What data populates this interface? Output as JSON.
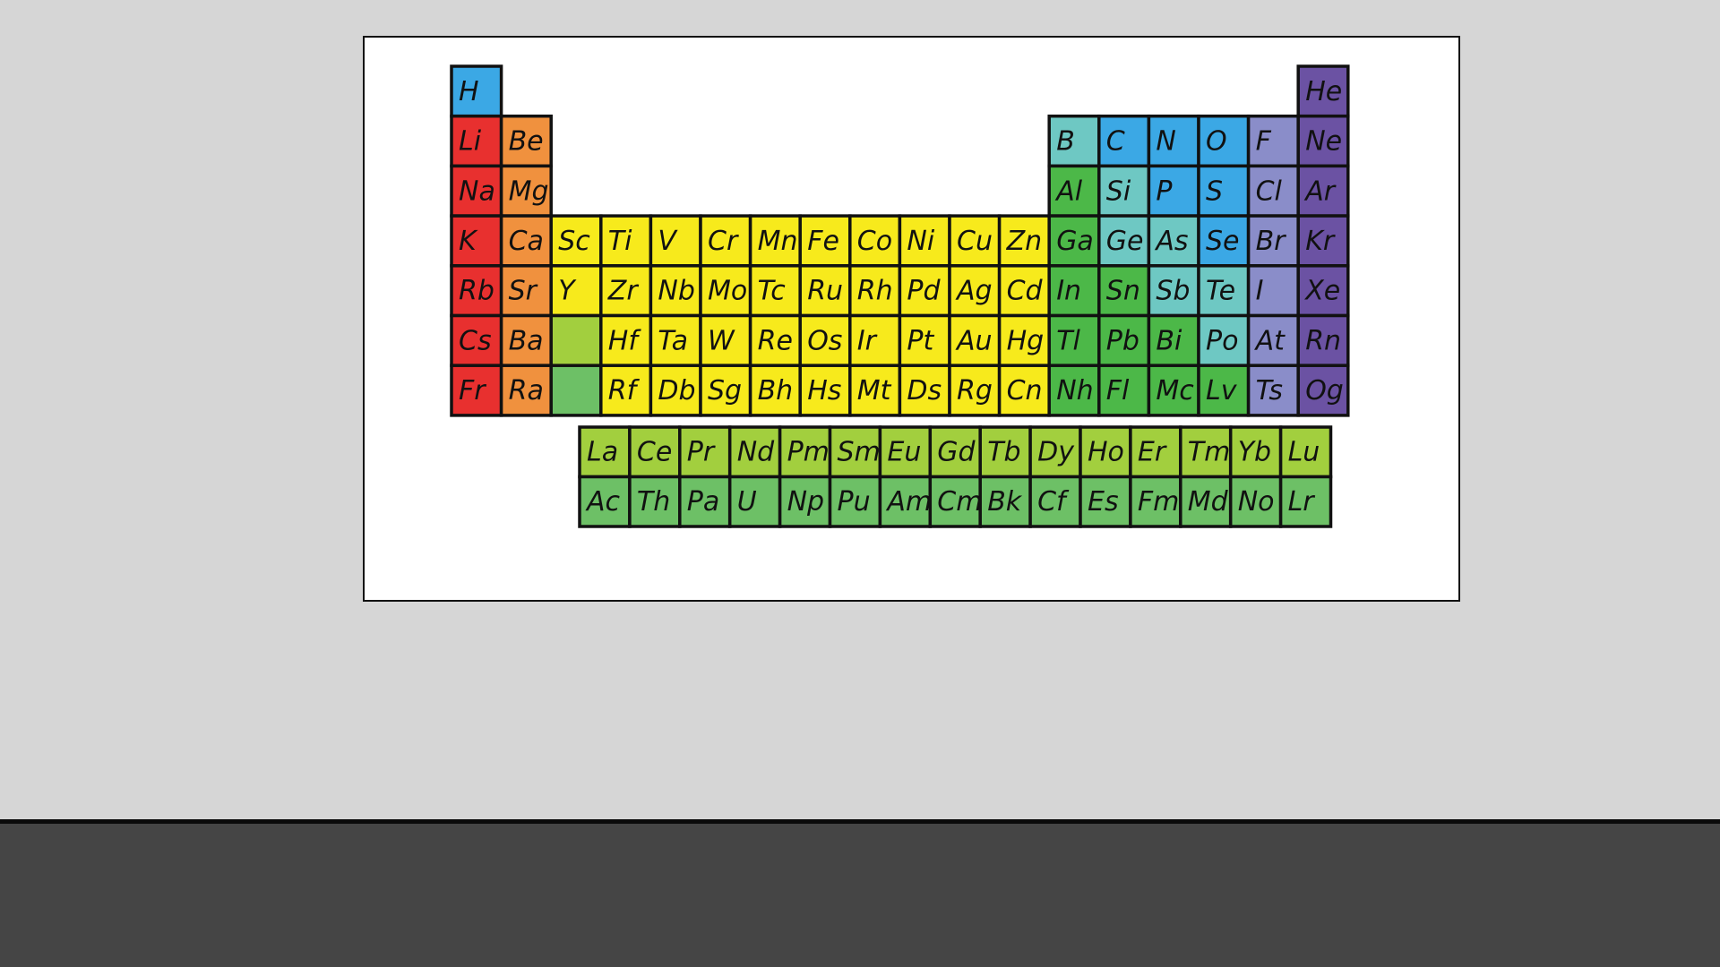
{
  "colors": {
    "page_background": "#d6d6d6",
    "card_background": "#ffffff",
    "bottom_bar": "#454545",
    "cell_border": "#111111",
    "alkali_metal": "#e8302f",
    "alkaline_earth": "#f0913e",
    "transition_metal": "#f7ea1c",
    "lanthanide": "#a2cf3e",
    "actinide": "#6dc066",
    "post_transition": "#4cb848",
    "metalloid": "#6ec8c3",
    "nonmetal": "#3ba8e5",
    "halogen": "#8a8dc9",
    "noble_gas": "#6b52a3"
  },
  "periodic_table": {
    "main": [
      [
        "H",
        "",
        "",
        "",
        "",
        "",
        "",
        "",
        "",
        "",
        "",
        "",
        "",
        "",
        "",
        "",
        "",
        "He"
      ],
      [
        "Li",
        "Be",
        "",
        "",
        "",
        "",
        "",
        "",
        "",
        "",
        "",
        "",
        "B",
        "C",
        "N",
        "O",
        "F",
        "Ne"
      ],
      [
        "Na",
        "Mg",
        "",
        "",
        "",
        "",
        "",
        "",
        "",
        "",
        "",
        "",
        "Al",
        "Si",
        "P",
        "S",
        "Cl",
        "Ar"
      ],
      [
        "K",
        "Ca",
        "Sc",
        "Ti",
        "V",
        "Cr",
        "Mn",
        "Fe",
        "Co",
        "Ni",
        "Cu",
        "Zn",
        "Ga",
        "Ge",
        "As",
        "Se",
        "Br",
        "Kr"
      ],
      [
        "Rb",
        "Sr",
        "Y",
        "Zr",
        "Nb",
        "Mo",
        "Tc",
        "Ru",
        "Rh",
        "Pd",
        "Ag",
        "Cd",
        "In",
        "Sn",
        "Sb",
        "Te",
        "I",
        "Xe"
      ],
      [
        "Cs",
        "Ba",
        "",
        "Hf",
        "Ta",
        "W",
        "Re",
        "Os",
        "Ir",
        "Pt",
        "Au",
        "Hg",
        "Tl",
        "Pb",
        "Bi",
        "Po",
        "At",
        "Rn"
      ],
      [
        "Fr",
        "Ra",
        "",
        "Rf",
        "Db",
        "Sg",
        "Bh",
        "Hs",
        "Mt",
        "Ds",
        "Rg",
        "Cn",
        "Nh",
        "Fl",
        "Mc",
        "Lv",
        "Ts",
        "Og"
      ]
    ],
    "main_categories": [
      [
        "nonmetal",
        "",
        "",
        "",
        "",
        "",
        "",
        "",
        "",
        "",
        "",
        "",
        "",
        "",
        "",
        "",
        "",
        "noble_gas"
      ],
      [
        "alkali_metal",
        "alkaline_earth",
        "",
        "",
        "",
        "",
        "",
        "",
        "",
        "",
        "",
        "",
        "metalloid",
        "nonmetal",
        "nonmetal",
        "nonmetal",
        "halogen",
        "noble_gas"
      ],
      [
        "alkali_metal",
        "alkaline_earth",
        "",
        "",
        "",
        "",
        "",
        "",
        "",
        "",
        "",
        "",
        "post_transition",
        "metalloid",
        "nonmetal",
        "nonmetal",
        "halogen",
        "noble_gas"
      ],
      [
        "alkali_metal",
        "alkaline_earth",
        "transition_metal",
        "transition_metal",
        "transition_metal",
        "transition_metal",
        "transition_metal",
        "transition_metal",
        "transition_metal",
        "transition_metal",
        "transition_metal",
        "transition_metal",
        "post_transition",
        "metalloid",
        "metalloid",
        "nonmetal",
        "halogen",
        "noble_gas"
      ],
      [
        "alkali_metal",
        "alkaline_earth",
        "transition_metal",
        "transition_metal",
        "transition_metal",
        "transition_metal",
        "transition_metal",
        "transition_metal",
        "transition_metal",
        "transition_metal",
        "transition_metal",
        "transition_metal",
        "post_transition",
        "post_transition",
        "metalloid",
        "metalloid",
        "halogen",
        "noble_gas"
      ],
      [
        "alkali_metal",
        "alkaline_earth",
        "lanthanide",
        "transition_metal",
        "transition_metal",
        "transition_metal",
        "transition_metal",
        "transition_metal",
        "transition_metal",
        "transition_metal",
        "transition_metal",
        "transition_metal",
        "post_transition",
        "post_transition",
        "post_transition",
        "metalloid",
        "halogen",
        "noble_gas"
      ],
      [
        "alkali_metal",
        "alkaline_earth",
        "actinide",
        "transition_metal",
        "transition_metal",
        "transition_metal",
        "transition_metal",
        "transition_metal",
        "transition_metal",
        "transition_metal",
        "transition_metal",
        "transition_metal",
        "post_transition",
        "post_transition",
        "post_transition",
        "post_transition",
        "halogen",
        "noble_gas"
      ]
    ],
    "lanthanides": [
      "La",
      "Ce",
      "Pr",
      "Nd",
      "Pm",
      "Sm",
      "Eu",
      "Gd",
      "Tb",
      "Dy",
      "Ho",
      "Er",
      "Tm",
      "Yb",
      "Lu"
    ],
    "actinides": [
      "Ac",
      "Th",
      "Pa",
      "U",
      "Np",
      "Pu",
      "Am",
      "Cm",
      "Bk",
      "Cf",
      "Es",
      "Fm",
      "Md",
      "No",
      "Lr"
    ]
  }
}
